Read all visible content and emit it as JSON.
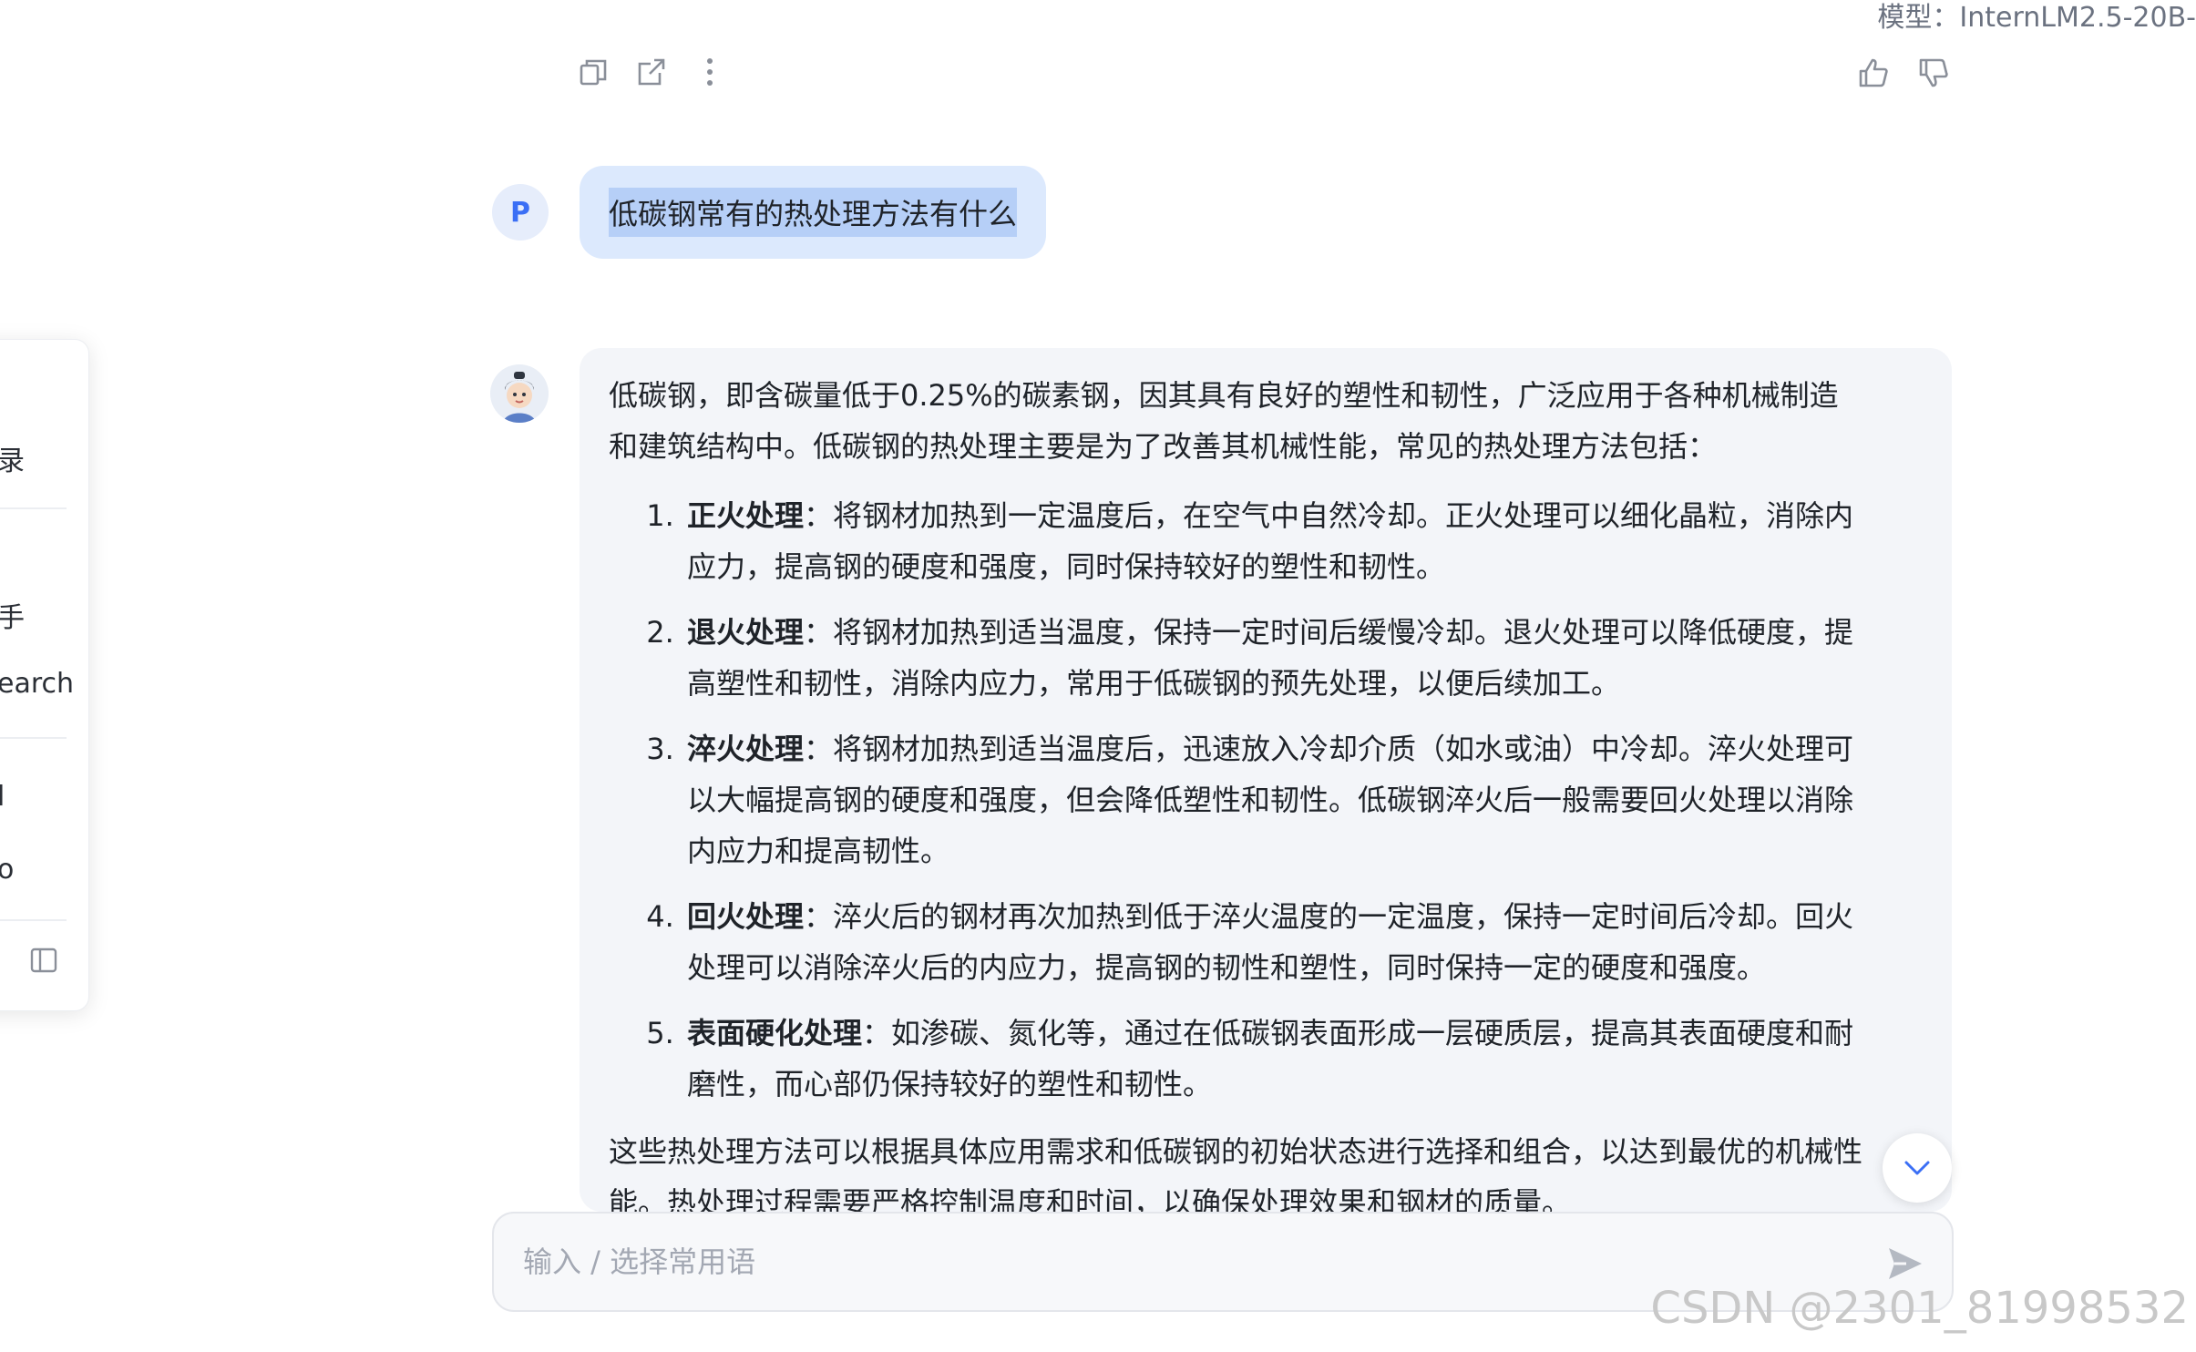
{
  "header": {
    "model_label": "模型：InternLM2.5-20B-"
  },
  "sidebar": {
    "items": [
      {
        "label": "录"
      },
      {
        "label": "手"
      },
      {
        "label": "earch"
      },
      {
        "label": "l"
      },
      {
        "label": "o"
      }
    ]
  },
  "icons": {
    "copy": "copy-icon",
    "share": "share-icon",
    "more": "more-icon",
    "like": "thumbs-up-icon",
    "dislike": "thumbs-down-icon",
    "sidebar_toggle": "sidebar-toggle-icon",
    "scroll_down": "chevron-down-icon",
    "send": "send-icon"
  },
  "user_message": {
    "avatar_letter": "P",
    "text": "低碳钢常有的热处理方法有什么"
  },
  "assistant_message": {
    "intro": "低碳钢，即含碳量低于0.25%的碳素钢，因其具有良好的塑性和韧性，广泛应用于各种机械制造和建筑结构中。低碳钢的热处理主要是为了改善其机械性能，常见的热处理方法包括：",
    "items": [
      {
        "title": "正火处理",
        "body": "：将钢材加热到一定温度后，在空气中自然冷却。正火处理可以细化晶粒，消除内应力，提高钢的硬度和强度，同时保持较好的塑性和韧性。"
      },
      {
        "title": "退火处理",
        "body": "：将钢材加热到适当温度，保持一定时间后缓慢冷却。退火处理可以降低硬度，提高塑性和韧性，消除内应力，常用于低碳钢的预先处理，以便后续加工。"
      },
      {
        "title": "淬火处理",
        "body": "：将钢材加热到适当温度后，迅速放入冷却介质（如水或油）中冷却。淬火处理可以大幅提高钢的硬度和强度，但会降低塑性和韧性。低碳钢淬火后一般需要回火处理以消除内应力和提高韧性。"
      },
      {
        "title": "回火处理",
        "body": "：淬火后的钢材再次加热到低于淬火温度的一定温度，保持一定时间后冷却。回火处理可以消除淬火后的内应力，提高钢的韧性和塑性，同时保持一定的硬度和强度。"
      },
      {
        "title": "表面硬化处理",
        "body": "：如渗碳、氮化等，通过在低碳钢表面形成一层硬质层，提高其表面硬度和耐磨性，而心部仍保持较好的塑性和韧性。"
      }
    ],
    "outro": "这些热处理方法可以根据具体应用需求和低碳钢的初始状态进行选择和组合，以达到最优的机械性能。热处理过程需要严格控制温度和时间，以确保处理效果和钢材的质量。"
  },
  "input": {
    "placeholder": "输入 / 选择常用语"
  },
  "watermark": "CSDN @2301_81998532",
  "colors": {
    "accent": "#3b6ff5",
    "user_bubble": "#dce9fd",
    "assistant_card": "#f3f5f9"
  }
}
